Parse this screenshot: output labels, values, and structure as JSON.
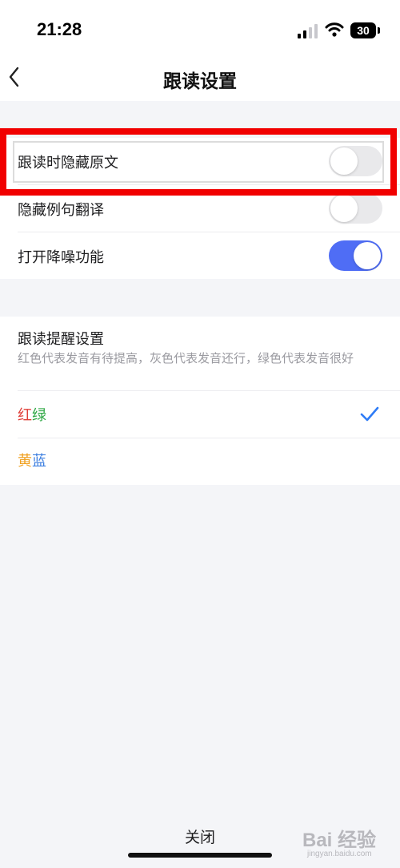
{
  "status_bar": {
    "time": "21:28",
    "battery": "30",
    "icons": [
      "signal-icon",
      "wifi-icon",
      "battery-icon"
    ]
  },
  "nav": {
    "title": "跟读设置",
    "back_icon": "chevron-left-icon"
  },
  "toggles": [
    {
      "label": "跟读时隐藏原文",
      "on": false
    },
    {
      "label": "隐藏例句翻译",
      "on": false
    },
    {
      "label": "打开降噪功能",
      "on": true
    }
  ],
  "reminder": {
    "title": "跟读提醒设置",
    "description": "红色代表发音有待提高，灰色代表发音还行，绿色代表发音很好",
    "options": [
      {
        "part1": "红",
        "part2": "绿",
        "color1": "#e0403a",
        "color2": "#2fa845",
        "selected": true
      },
      {
        "part1": "黄",
        "part2": "蓝",
        "color1": "#f0a020",
        "color2": "#3d7fe0",
        "selected": false
      }
    ]
  },
  "bottom": {
    "label": "关闭"
  },
  "watermark": {
    "main": "Bai 经验",
    "sub": "jingyan.baidu.com"
  },
  "colors": {
    "accent": "#4f6df5",
    "check": "#2f7cf6",
    "highlight": "#f10000",
    "background": "#f4f5f8"
  }
}
